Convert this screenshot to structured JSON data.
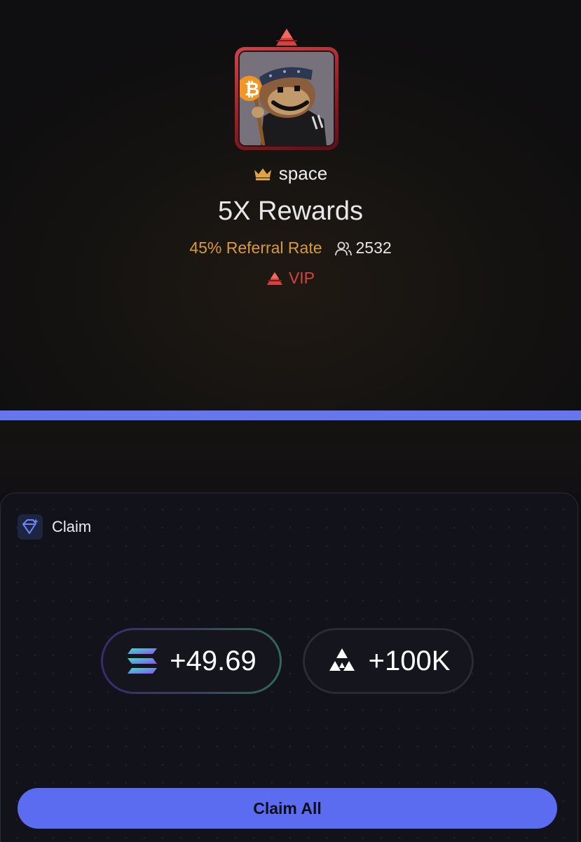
{
  "profile": {
    "rank_icon": "vip-triangle-icon",
    "avatar_icon": "monkey-bitcoin-avatar",
    "owner_icon": "crown-icon",
    "owner_name": "space"
  },
  "rewards": {
    "title": "5X Rewards",
    "referral_rate": "45% Referral Rate",
    "members_icon": "users-icon",
    "members_count": "2532",
    "tier_icon": "vip-triangle-icon",
    "tier_label": "VIP"
  },
  "claim": {
    "icon": "diamond-sparkle-icon",
    "label": "Claim",
    "tokens": [
      {
        "icon": "solana-icon",
        "amount": "+49.69"
      },
      {
        "icon": "triangle-points-icon",
        "amount": "+100K"
      }
    ],
    "button_label": "Claim All"
  },
  "colors": {
    "accent": "#5b6cf1",
    "divider": "#6675f0",
    "referral": "#d79a3f",
    "vip": "#d6433f",
    "background": "#0f0e10"
  }
}
